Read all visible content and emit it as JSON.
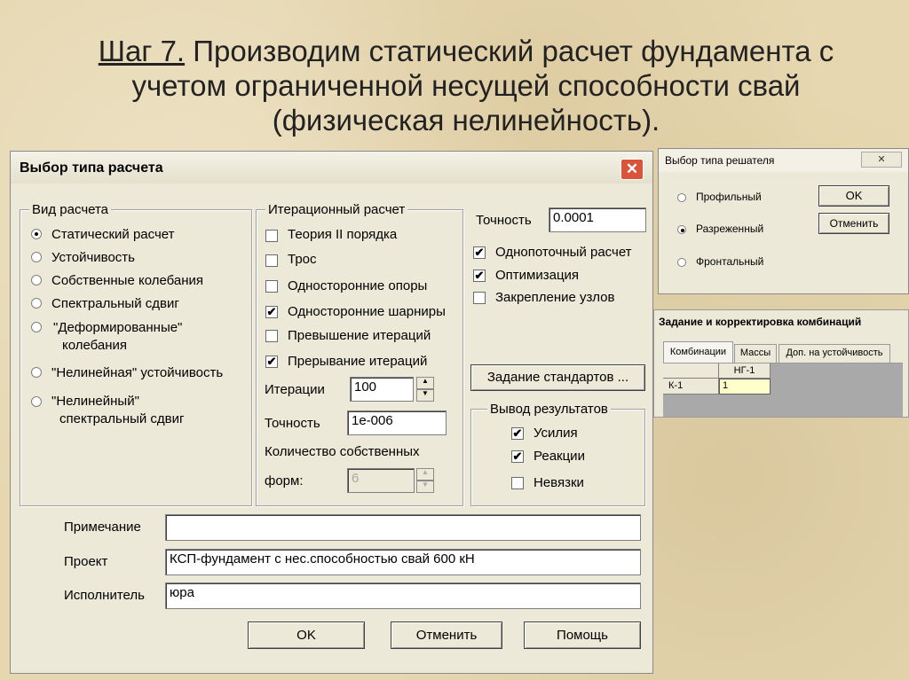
{
  "slide": {
    "step": "Шаг 7.",
    "line1": " Производим статический расчет фундамента с",
    "line2": "учетом ограниченной несущей способности свай",
    "line3": "(физическая нелинейность)."
  },
  "main_dialog": {
    "title": "Выбор типа расчета",
    "close_glyph": "✕",
    "calc_type_group": "Вид расчета",
    "calc_types": [
      {
        "label": "Статический расчет",
        "selected": true
      },
      {
        "label": "Устойчивость",
        "selected": false
      },
      {
        "label": "Собственные колебания",
        "selected": false
      },
      {
        "label": "Спектральный сдвиг",
        "selected": false
      },
      {
        "label": "\"Деформированные\"",
        "label2": "колебания",
        "selected": false
      },
      {
        "label": "\"Нелинейная\" устойчивость",
        "selected": false
      },
      {
        "label": "\"Нелинейный\"",
        "label2": "спектральный  сдвиг",
        "selected": false
      }
    ],
    "iter_group": "Итерационный расчет",
    "iter_options": [
      {
        "label": "Теория II порядка",
        "checked": false
      },
      {
        "label": "Трос",
        "checked": false
      },
      {
        "label": "Односторонние опоры",
        "checked": false
      },
      {
        "label": "Односторонние шарниры",
        "checked": true
      },
      {
        "label": "Превышение итераций",
        "checked": false
      },
      {
        "label": "Прерывание итераций",
        "checked": true
      }
    ],
    "iterations_label": "Итерации",
    "iterations_value": "100",
    "iter_accuracy_label": "Точность",
    "iter_accuracy_value": "1e-006",
    "eigen_forms_label1": "Количество собственных",
    "eigen_forms_label2": "форм:",
    "eigen_forms_value": "6",
    "accuracy_label": "Точность",
    "accuracy_value": "0.0001",
    "right_options": [
      {
        "label": "Однопоточный расчет",
        "checked": true
      },
      {
        "label": "Оптимизация",
        "checked": true
      },
      {
        "label": "Закрепление узлов",
        "checked": false
      }
    ],
    "standards_button": "Задание стандартов ...",
    "output_group": "Вывод результатов",
    "output_options": [
      {
        "label": "Усилия",
        "checked": true
      },
      {
        "label": "Реакции",
        "checked": true
      },
      {
        "label": "Невязки",
        "checked": false
      }
    ],
    "note_label": "Примечание",
    "note_value": "",
    "project_label": "Проект",
    "project_value": "КСП-фундамент с нес.способностью свай 600 кН",
    "executor_label": "Исполнитель",
    "executor_value": "юра",
    "ok_button": "OK",
    "cancel_button": "Отменить",
    "help_button": "Помощь"
  },
  "solver_dialog": {
    "title": "Выбор типа решателя",
    "close_glyph": "✕",
    "options": [
      {
        "label": "Профильный",
        "selected": false
      },
      {
        "label": "Разреженный",
        "selected": true
      },
      {
        "label": "Фронтальный",
        "selected": false
      }
    ],
    "ok_button": "OK",
    "cancel_button": "Отменить"
  },
  "combo_dialog": {
    "title": "Задание и корректировка комбинаций",
    "tabs": [
      "Комбинации",
      "Массы",
      "Доп. на устойчивость"
    ],
    "column_header": "НГ-1",
    "row_header": "К-1",
    "cell_value": "1"
  }
}
